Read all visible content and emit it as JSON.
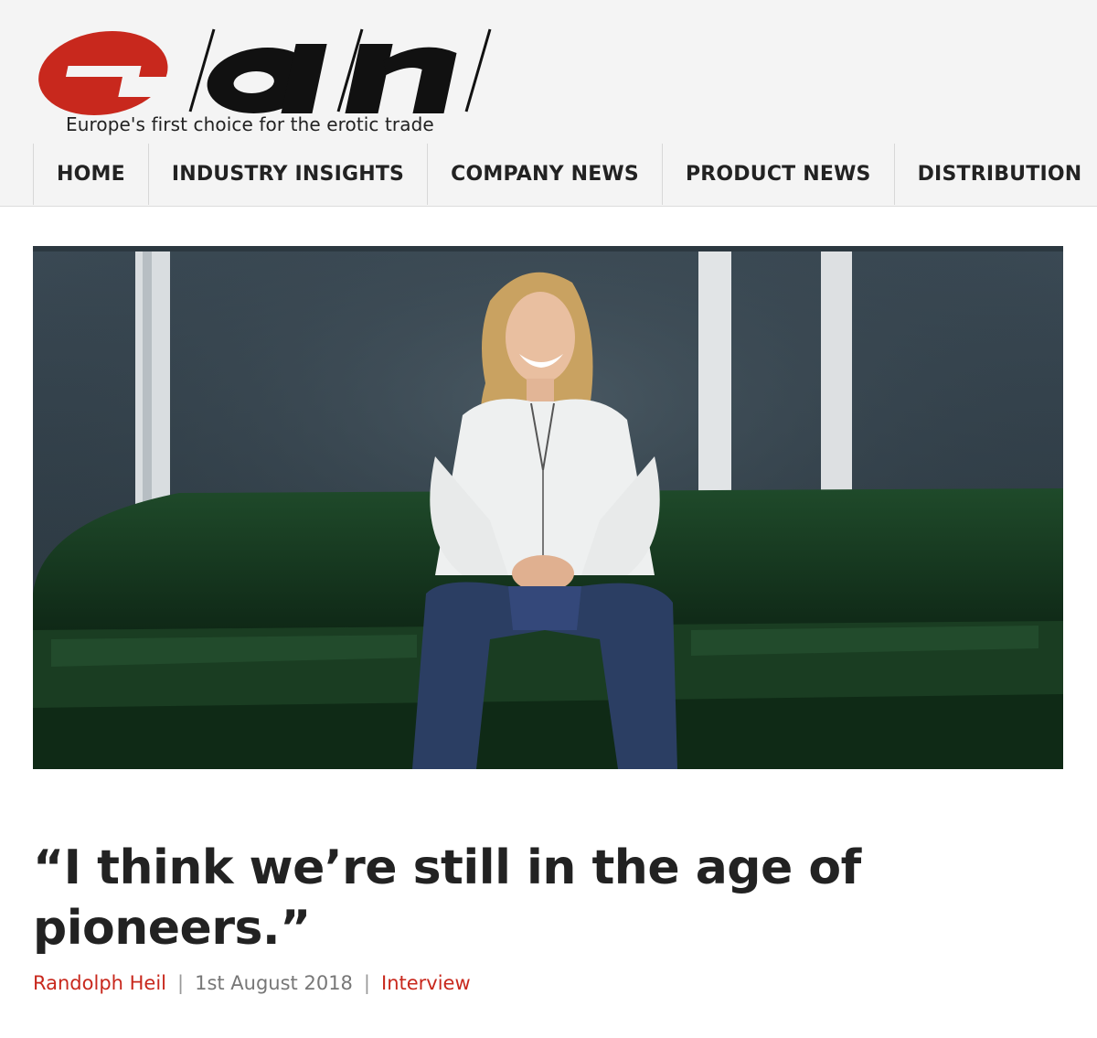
{
  "header": {
    "logo": {
      "letters": [
        "e",
        "a",
        "n"
      ],
      "colors": {
        "e": "#c8281d",
        "an": "#111111"
      }
    },
    "tagline": "Europe's first choice for the erotic trade"
  },
  "nav": {
    "items": [
      {
        "label": "HOME"
      },
      {
        "label": "INDUSTRY INSIGHTS"
      },
      {
        "label": "COMPANY NEWS"
      },
      {
        "label": "PRODUCT NEWS"
      },
      {
        "label": "DISTRIBUTION"
      }
    ]
  },
  "article": {
    "title": "“I think we’re still in the age of pioneers.”",
    "author": "Randolph Heil",
    "date": "1st August 2018",
    "category": "Interview",
    "separator": "|"
  },
  "colors": {
    "accent": "#c8281d",
    "text": "#222222",
    "meta_gray": "#777777",
    "header_bg": "#f4f4f4"
  }
}
